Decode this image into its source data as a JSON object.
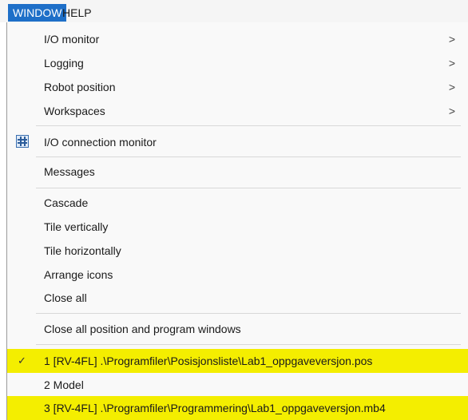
{
  "menubar": {
    "window_label": "WINDOW",
    "help_label": "HELP"
  },
  "menu": {
    "io_monitor": "I/O monitor",
    "logging": "Logging",
    "robot_position": "Robot position",
    "workspaces": "Workspaces",
    "submenu_chevron": ">",
    "io_connection_monitor": "I/O connection monitor",
    "messages": "Messages",
    "cascade": "Cascade",
    "tile_vertically": "Tile vertically",
    "tile_horizontally": "Tile horizontally",
    "arrange_icons": "Arrange icons",
    "close_all": "Close all",
    "close_all_position_program": "Close all position and program windows",
    "window_list": [
      {
        "label": "1 [RV-4FL] .\\Programfiler\\Posisjonsliste\\Lab1_oppgaveversjon.pos",
        "checked": true,
        "highlighted": true
      },
      {
        "label": "2 Model",
        "checked": false,
        "highlighted": false
      },
      {
        "label": "3 [RV-4FL] .\\Programfiler\\Programmering\\Lab1_oppgaveversjon.mb4",
        "checked": false,
        "highlighted": true
      }
    ],
    "check_mark": "✓"
  },
  "colors": {
    "menubar_active": "#1e6fc8",
    "highlight": "#f4ee00",
    "menu_bg": "#f9f9f9"
  },
  "icons": {
    "io_connection_monitor": "io-connection-monitor-icon"
  }
}
